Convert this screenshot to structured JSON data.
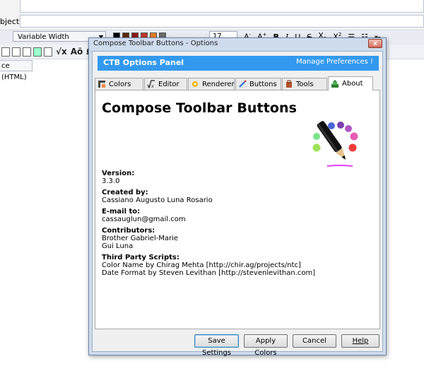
{
  "background": {
    "subject_label": "bject:",
    "font_select": "Variable Width",
    "font_size": "17",
    "html_tab": "ce (HTML)",
    "swatch_colors": [
      "#000000",
      "#5a2a0a",
      "#8b1a1a",
      "#c0392b",
      "#e67e22",
      "#6b6b6b"
    ]
  },
  "dialog": {
    "title": "Compose Toolbar Buttons - Options",
    "close_symbol": "x",
    "panel_title": "CTB Options Panel",
    "manage_link": "Manage Preferences !",
    "tabs": [
      {
        "label": "Colors",
        "icon": "colors-icon"
      },
      {
        "label": "Editor",
        "icon": "editor-icon"
      },
      {
        "label": "Renderer",
        "icon": "renderer-icon"
      },
      {
        "label": "Buttons",
        "icon": "buttons-icon"
      },
      {
        "label": "Tools",
        "icon": "tools-icon"
      },
      {
        "label": "About",
        "icon": "about-icon"
      }
    ],
    "active_tab": "About",
    "about": {
      "heading": "Compose Toolbar Buttons",
      "version_label": "Version:",
      "version": "3.3.0",
      "created_label": "Created by:",
      "created": "Cassiano Augusto Luna Rosario",
      "email_label": "E-mail to:",
      "email": "cassauglun@gmail.com",
      "contributors_label": "Contributors:",
      "contributors": [
        "Brother Gabriel-Marie",
        "Gui Luna"
      ],
      "third_party_label": "Third Party Scripts:",
      "third_party": [
        "Color Name by Chirag Mehta [http://chir.ag/projects/ntc]",
        "Date Format by Steven Levithan [http://stevenlevithan.com]"
      ]
    },
    "buttons": {
      "save": "Save Settings",
      "apply": "Apply Colors",
      "cancel": "Cancel",
      "help": "Help"
    },
    "accent_color": "#3399ee"
  }
}
